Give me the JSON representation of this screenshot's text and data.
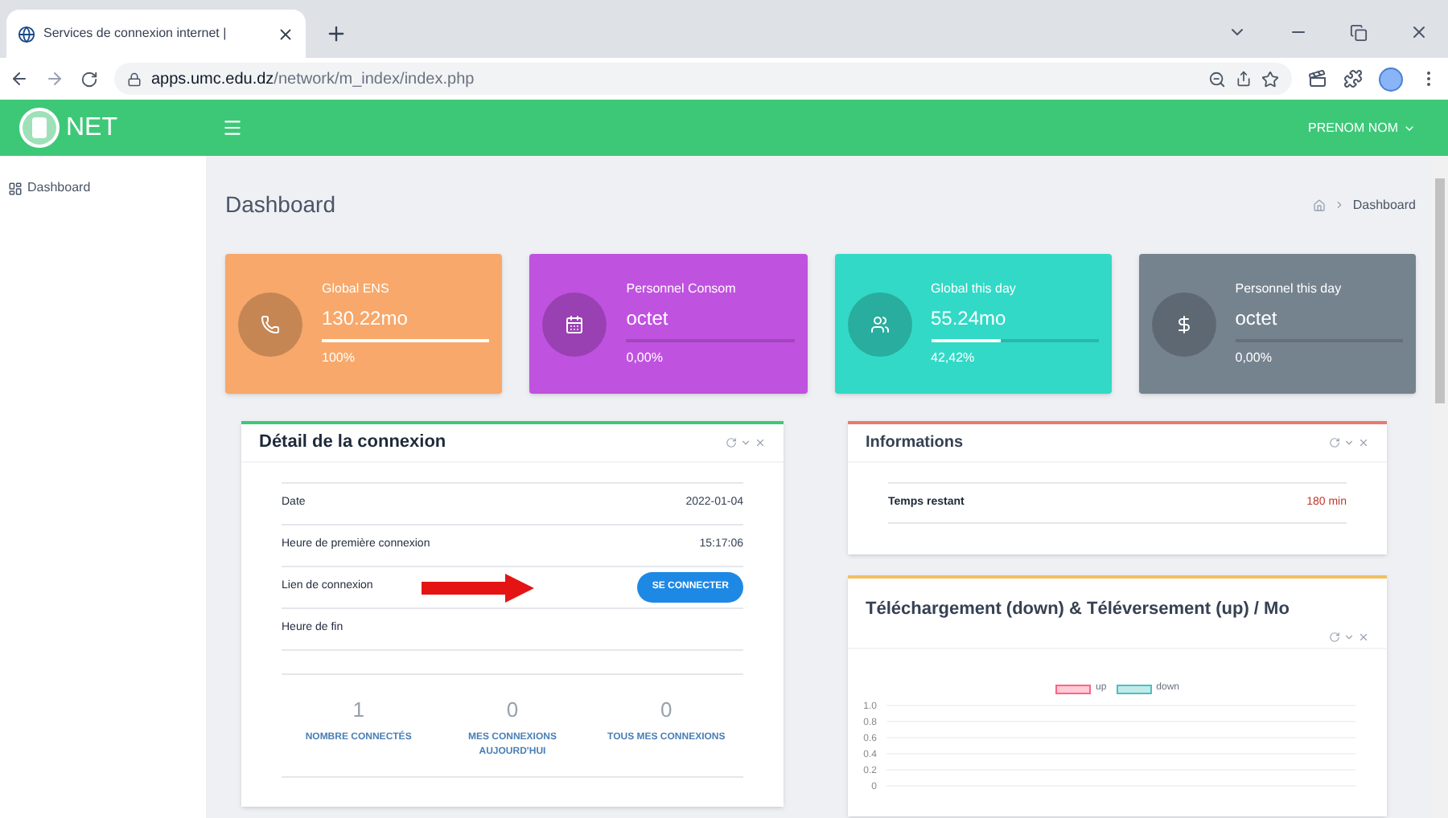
{
  "browser": {
    "tab_title": "Services de connexion internet | ",
    "url_host": "apps.umc.edu.dz",
    "url_path": "/network/m_index/index.php"
  },
  "navbar": {
    "brand": "NET",
    "user": "PRENOM NOM"
  },
  "sidebar": {
    "items": [
      {
        "label": "Dashboard"
      }
    ]
  },
  "page": {
    "title": "Dashboard",
    "breadcrumb": [
      "Dashboard"
    ]
  },
  "stat_cards": [
    {
      "title": "Global ENS",
      "value": "130.22mo",
      "percent": "100%",
      "level": 1,
      "color": "#f7a86a"
    },
    {
      "title": "Personnel Consom",
      "value": "octet",
      "percent": "0,00%",
      "level": 0,
      "color": "#c052e0"
    },
    {
      "title": "Global this day",
      "value": "55.24mo",
      "percent": "42,42%",
      "level": 0.42,
      "color": "#32d9c6"
    },
    {
      "title": "Personnel this day",
      "value": "octet",
      "percent": "0,00%",
      "level": 0,
      "color": "#75838f"
    }
  ],
  "connection_panel": {
    "title": "Détail de la connexion",
    "rows": [
      {
        "kind": "text",
        "label": "Date",
        "value": "2022-01-04"
      },
      {
        "kind": "text",
        "label": "Heure de première connexion",
        "value": "15:17:06"
      },
      {
        "kind": "button",
        "label": "Lien de connexion",
        "value": "SE CONNECTER"
      },
      {
        "kind": "text",
        "label": "Heure de fin"
      }
    ],
    "stats": [
      {
        "value": "1",
        "label": "NOMBRE CONNECTÉS"
      },
      {
        "value": "0",
        "label": "MES CONNEXIONS AUJOURD'HUI"
      },
      {
        "value": "0",
        "label": "TOUS MES CONNEXIONS"
      }
    ]
  },
  "info_panel": {
    "title": "Informations",
    "rows": [
      {
        "label": "Temps restant",
        "value": "180 min"
      }
    ]
  },
  "chart_panel": {
    "title": "Téléchargement (down) & Téléversement (up) / Mo",
    "chart_data": {
      "type": "line",
      "grid": true,
      "series": [
        {
          "name": "up",
          "color": "#ff6384"
        },
        {
          "name": "down",
          "color": "#4bc0c0"
        }
      ],
      "ylim": [
        0,
        1
      ],
      "yticks": [
        {
          "value": 1,
          "label": "1.0"
        },
        {
          "value": 0.8,
          "label": "0.8"
        },
        {
          "value": 0.6,
          "label": "0.6"
        },
        {
          "value": 0.4,
          "label": "0.4"
        },
        {
          "value": 0.2,
          "label": "0.2"
        },
        {
          "value": 0,
          "label": "0"
        }
      ]
    }
  }
}
